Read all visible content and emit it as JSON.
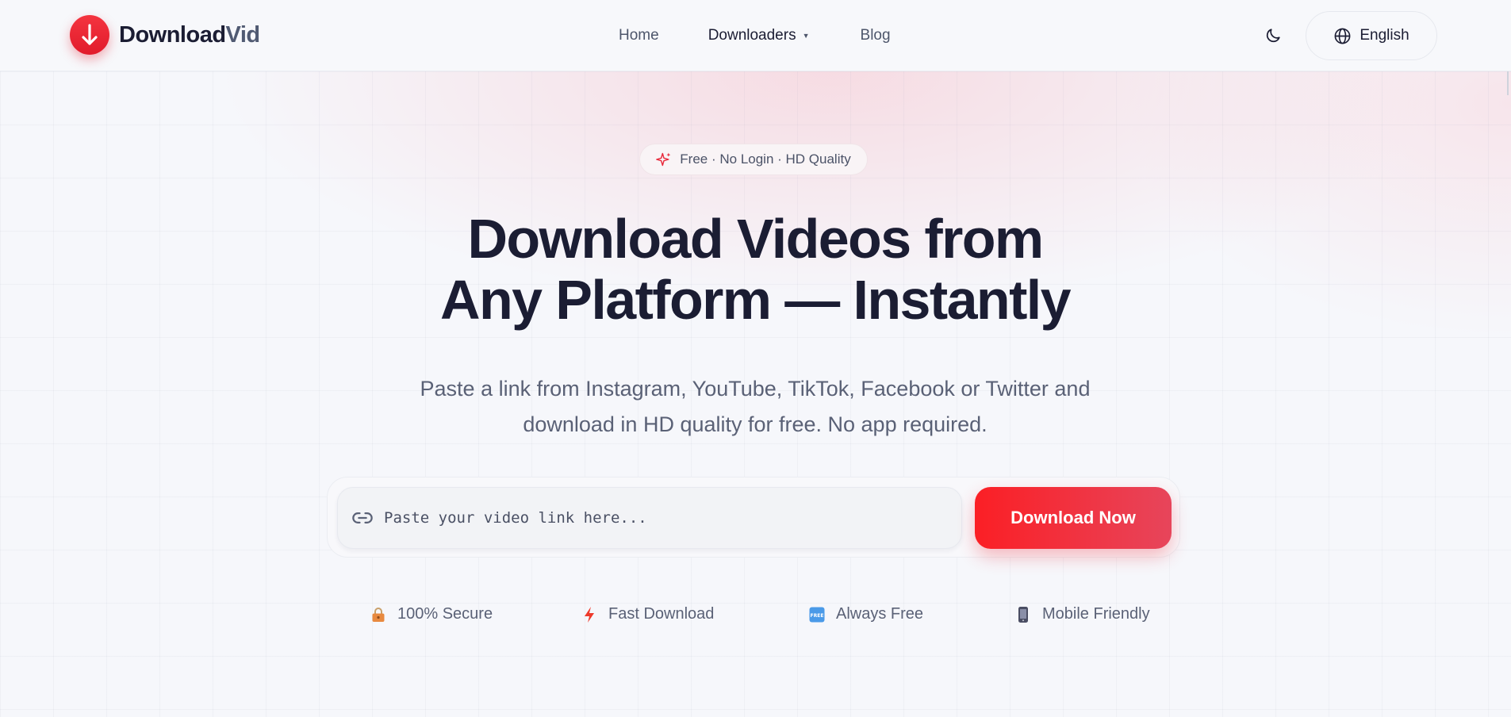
{
  "brand": {
    "name_part1": "Download",
    "name_part2": "Vid",
    "accent": "#e11b2b"
  },
  "nav": {
    "home": "Home",
    "downloaders": "Downloaders",
    "blog": "Blog"
  },
  "header": {
    "theme_icon": "moon-icon",
    "language": "English",
    "language_icon": "globe-icon"
  },
  "hero": {
    "badge": "Free · No Login · HD Quality",
    "title_line1": "Download Videos from",
    "title_line2": "Any Platform — Instantly",
    "subtitle_line1": "Paste a link from Instagram, YouTube, TikTok, Facebook or Twitter and",
    "subtitle_line2": "download in HD quality for free. No app required."
  },
  "search": {
    "placeholder": "Paste your video link here...",
    "value": "",
    "button_label": "Download Now",
    "button_gradient": [
      "#fb1f25",
      "#e7455b"
    ]
  },
  "features": [
    {
      "icon": "lock-icon",
      "label": "100% Secure"
    },
    {
      "icon": "lightning-icon",
      "label": "Fast Download"
    },
    {
      "icon": "free-badge-icon",
      "label": "Always Free"
    },
    {
      "icon": "mobile-icon",
      "label": "Mobile Friendly"
    }
  ]
}
